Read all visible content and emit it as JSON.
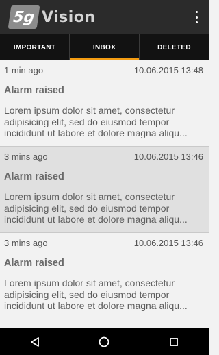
{
  "app": {
    "logo_badge": "5g",
    "logo_text": "Vision",
    "overflow_icon": "more-vert-icon"
  },
  "tabs": [
    {
      "label": "IMPORTANT",
      "active": false
    },
    {
      "label": "INBOX",
      "active": true
    },
    {
      "label": "DELETED",
      "active": false
    }
  ],
  "accent_color": "#f39c12",
  "messages": [
    {
      "age": "1 min ago",
      "timestamp": "10.06.2015 13:48",
      "title": "Alarm raised",
      "body": "Lorem ipsum dolor sit amet, consectetur adipisicing elit, sed do eiusmod tempor incididunt ut labore et dolore magna aliqu..."
    },
    {
      "age": "3 mins ago",
      "timestamp": "10.06.2015 13:46",
      "title": "Alarm raised",
      "body": "Lorem ipsum dolor sit amet, consectetur adipisicing elit, sed do eiusmod tempor incididunt ut labore et dolore magna aliqu..."
    },
    {
      "age": "3 mins ago",
      "timestamp": "10.06.2015 13:46",
      "title": "Alarm raised",
      "body": "Lorem ipsum dolor sit amet, consectetur adipisicing elit, sed do eiusmod tempor incididunt ut labore et dolore magna aliqu..."
    }
  ],
  "navigation": {
    "back_icon": "back-triangle-icon",
    "home_icon": "home-circle-icon",
    "recents_icon": "recents-square-icon"
  }
}
